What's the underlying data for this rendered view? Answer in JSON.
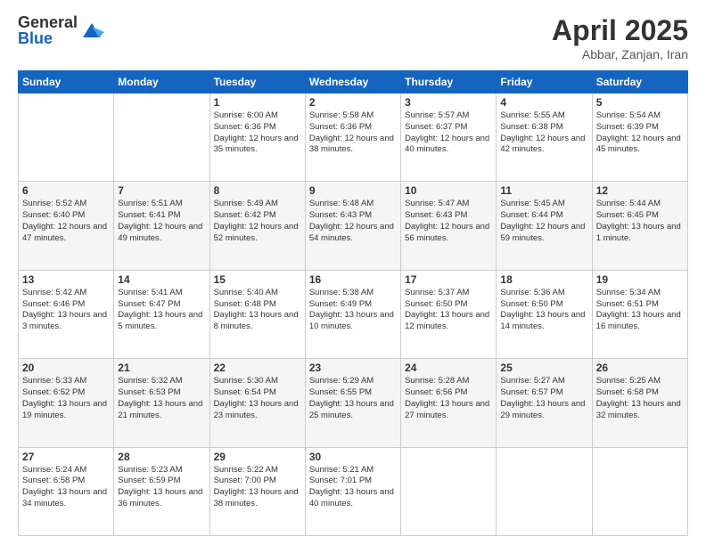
{
  "header": {
    "logo_general": "General",
    "logo_blue": "Blue",
    "month_title": "April 2025",
    "subtitle": "Abbar, Zanjan, Iran"
  },
  "days_of_week": [
    "Sunday",
    "Monday",
    "Tuesday",
    "Wednesday",
    "Thursday",
    "Friday",
    "Saturday"
  ],
  "weeks": [
    [
      {
        "day": "",
        "info": ""
      },
      {
        "day": "",
        "info": ""
      },
      {
        "day": "1",
        "info": "Sunrise: 6:00 AM\nSunset: 6:36 PM\nDaylight: 12 hours and 35 minutes."
      },
      {
        "day": "2",
        "info": "Sunrise: 5:58 AM\nSunset: 6:36 PM\nDaylight: 12 hours and 38 minutes."
      },
      {
        "day": "3",
        "info": "Sunrise: 5:57 AM\nSunset: 6:37 PM\nDaylight: 12 hours and 40 minutes."
      },
      {
        "day": "4",
        "info": "Sunrise: 5:55 AM\nSunset: 6:38 PM\nDaylight: 12 hours and 42 minutes."
      },
      {
        "day": "5",
        "info": "Sunrise: 5:54 AM\nSunset: 6:39 PM\nDaylight: 12 hours and 45 minutes."
      }
    ],
    [
      {
        "day": "6",
        "info": "Sunrise: 5:52 AM\nSunset: 6:40 PM\nDaylight: 12 hours and 47 minutes."
      },
      {
        "day": "7",
        "info": "Sunrise: 5:51 AM\nSunset: 6:41 PM\nDaylight: 12 hours and 49 minutes."
      },
      {
        "day": "8",
        "info": "Sunrise: 5:49 AM\nSunset: 6:42 PM\nDaylight: 12 hours and 52 minutes."
      },
      {
        "day": "9",
        "info": "Sunrise: 5:48 AM\nSunset: 6:43 PM\nDaylight: 12 hours and 54 minutes."
      },
      {
        "day": "10",
        "info": "Sunrise: 5:47 AM\nSunset: 6:43 PM\nDaylight: 12 hours and 56 minutes."
      },
      {
        "day": "11",
        "info": "Sunrise: 5:45 AM\nSunset: 6:44 PM\nDaylight: 12 hours and 59 minutes."
      },
      {
        "day": "12",
        "info": "Sunrise: 5:44 AM\nSunset: 6:45 PM\nDaylight: 13 hours and 1 minute."
      }
    ],
    [
      {
        "day": "13",
        "info": "Sunrise: 5:42 AM\nSunset: 6:46 PM\nDaylight: 13 hours and 3 minutes."
      },
      {
        "day": "14",
        "info": "Sunrise: 5:41 AM\nSunset: 6:47 PM\nDaylight: 13 hours and 5 minutes."
      },
      {
        "day": "15",
        "info": "Sunrise: 5:40 AM\nSunset: 6:48 PM\nDaylight: 13 hours and 8 minutes."
      },
      {
        "day": "16",
        "info": "Sunrise: 5:38 AM\nSunset: 6:49 PM\nDaylight: 13 hours and 10 minutes."
      },
      {
        "day": "17",
        "info": "Sunrise: 5:37 AM\nSunset: 6:50 PM\nDaylight: 13 hours and 12 minutes."
      },
      {
        "day": "18",
        "info": "Sunrise: 5:36 AM\nSunset: 6:50 PM\nDaylight: 13 hours and 14 minutes."
      },
      {
        "day": "19",
        "info": "Sunrise: 5:34 AM\nSunset: 6:51 PM\nDaylight: 13 hours and 16 minutes."
      }
    ],
    [
      {
        "day": "20",
        "info": "Sunrise: 5:33 AM\nSunset: 6:52 PM\nDaylight: 13 hours and 19 minutes."
      },
      {
        "day": "21",
        "info": "Sunrise: 5:32 AM\nSunset: 6:53 PM\nDaylight: 13 hours and 21 minutes."
      },
      {
        "day": "22",
        "info": "Sunrise: 5:30 AM\nSunset: 6:54 PM\nDaylight: 13 hours and 23 minutes."
      },
      {
        "day": "23",
        "info": "Sunrise: 5:29 AM\nSunset: 6:55 PM\nDaylight: 13 hours and 25 minutes."
      },
      {
        "day": "24",
        "info": "Sunrise: 5:28 AM\nSunset: 6:56 PM\nDaylight: 13 hours and 27 minutes."
      },
      {
        "day": "25",
        "info": "Sunrise: 5:27 AM\nSunset: 6:57 PM\nDaylight: 13 hours and 29 minutes."
      },
      {
        "day": "26",
        "info": "Sunrise: 5:25 AM\nSunset: 6:58 PM\nDaylight: 13 hours and 32 minutes."
      }
    ],
    [
      {
        "day": "27",
        "info": "Sunrise: 5:24 AM\nSunset: 6:58 PM\nDaylight: 13 hours and 34 minutes."
      },
      {
        "day": "28",
        "info": "Sunrise: 5:23 AM\nSunset: 6:59 PM\nDaylight: 13 hours and 36 minutes."
      },
      {
        "day": "29",
        "info": "Sunrise: 5:22 AM\nSunset: 7:00 PM\nDaylight: 13 hours and 38 minutes."
      },
      {
        "day": "30",
        "info": "Sunrise: 5:21 AM\nSunset: 7:01 PM\nDaylight: 13 hours and 40 minutes."
      },
      {
        "day": "",
        "info": ""
      },
      {
        "day": "",
        "info": ""
      },
      {
        "day": "",
        "info": ""
      }
    ]
  ]
}
